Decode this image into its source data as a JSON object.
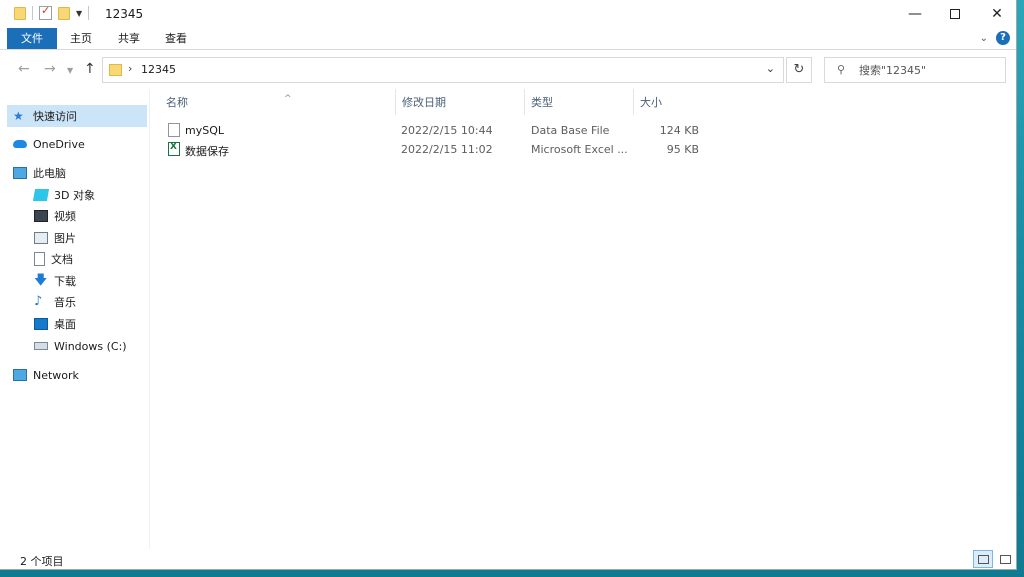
{
  "window": {
    "title": "12345",
    "controls": {
      "minimize": "—",
      "restore": "☐",
      "close": "✕"
    }
  },
  "ribbon": {
    "tabs": [
      "文件",
      "主页",
      "共享",
      "查看"
    ]
  },
  "address": {
    "path": "12345",
    "separator": "›"
  },
  "search": {
    "placeholder": "搜索\"12345\""
  },
  "sidebar": {
    "quick_access": "快速访问",
    "onedrive": "OneDrive",
    "this_pc": "此电脑",
    "items": [
      "3D 对象",
      "视频",
      "图片",
      "文档",
      "下载",
      "音乐",
      "桌面",
      "Windows (C:)"
    ],
    "network": "Network"
  },
  "columns": {
    "name": "名称",
    "date": "修改日期",
    "type": "类型",
    "size": "大小"
  },
  "files": [
    {
      "name": "mySQL",
      "date": "2022/2/15 10:44",
      "type": "Data Base File",
      "size": "124 KB",
      "icon": "database-file-icon"
    },
    {
      "name": "数据保存",
      "date": "2022/2/15 11:02",
      "type": "Microsoft Excel ...",
      "size": "95 KB",
      "icon": "excel-file-icon"
    }
  ],
  "status": {
    "item_count": "2 个项目"
  }
}
